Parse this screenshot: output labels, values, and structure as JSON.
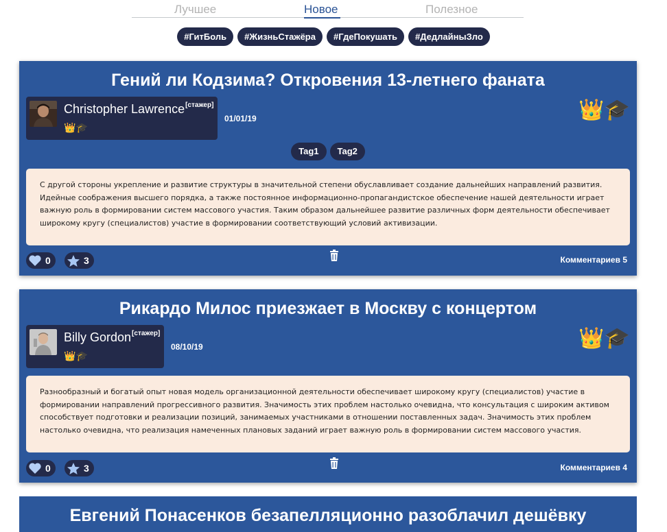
{
  "tabs": [
    {
      "label": "Лучшее"
    },
    {
      "label": "Новое"
    },
    {
      "label": "Полезное"
    }
  ],
  "hashtags": [
    "#ГитБоль",
    "#ЖизньСтажёра",
    "#ГдеПокушать",
    "#ДедлайныЗло"
  ],
  "posts": [
    {
      "title": "Гений ли Кодзима? Откровения 13-летнего фаната",
      "author": {
        "name": "Christopher Lawrence",
        "role": "[стажер]"
      },
      "date": "01/01/19",
      "tags": [
        "Tag1",
        "Tag2"
      ],
      "content": "С другой стороны укрепление и развитие структуры в значительной степени обуславливает создание дальнейших направлений развития. Идейные соображения высшего порядка, а также постоянное информационно-пропагандистское обеспечение нашей деятельности играет важную роль в формировании систем массового участия. Таким образом дальнейшее развитие различных форм деятельности обеспечивает широкому кругу (специалистов) участие в формировании соответствующий условий активизации.",
      "likes": "0",
      "favorites": "3",
      "comments": "Комментариев 5"
    },
    {
      "title": "Рикардо Милос приезжает в Москву с концертом",
      "author": {
        "name": "Billy Gordon",
        "role": "[стажер]"
      },
      "date": "08/10/19",
      "tags": [],
      "content": "Разнообразный и богатый опыт новая модель организационной деятельности обеспечивает широкому кругу (специалистов) участие в формировании направлений прогрессивного развития. Значимость этих проблем настолько очевидна, что консультация с широким активом способствует подготовки и реализации позиций, занимаемых участниками в отношении поставленных задач. Значимость этих проблем настолько очевидна, что реализация намеченных плановых заданий играет важную роль в формировании систем массового участия.",
      "likes": "0",
      "favorites": "3",
      "comments": "Комментариев 4"
    },
    {
      "title": "Евгений Понасенков безапелляционно разоблачил дешёвку"
    }
  ],
  "icons": {
    "crown": "crown-icon",
    "graduation_cap": "graduation-cap-icon",
    "heart": "heart-icon",
    "star": "star-icon",
    "trash": "trash-icon"
  },
  "colors": {
    "card_bg": "#2c579b",
    "dark_pill": "#232a4a",
    "content_bg": "#fbebdf",
    "active_tab": "#2a5395",
    "inactive_tab": "#b3b3b3"
  }
}
